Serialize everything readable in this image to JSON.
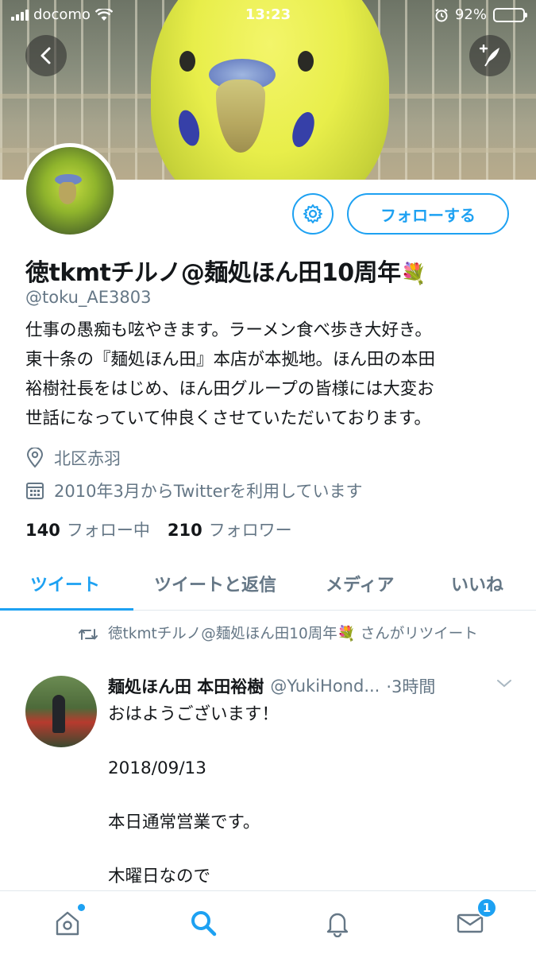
{
  "status_bar": {
    "carrier": "docomo",
    "time": "13:23",
    "battery": "92%",
    "battery_level": 0.92
  },
  "profile": {
    "display_name": "徳tkmtチルノ@麺処ほん田10周年",
    "display_name_emoji": "💐",
    "handle": "@toku_AE3803",
    "bio_lines": [
      "仕事の愚痴も呟やきます。ラーメン食べ歩き大好き。",
      "東十条の『麺処ほん田』本店が本拠地。ほん田の本田",
      "裕樹社長をはじめ、ほん田グループの皆様には大変お",
      "世話になっていて仲良くさせていただいております。"
    ],
    "location": "北区赤羽",
    "joined": "2010年3月からTwitterを利用しています",
    "following_count": "140",
    "following_label": "フォロー中",
    "followers_count": "210",
    "followers_label": "フォロワー",
    "follow_button": "フォローする"
  },
  "tabs": [
    "ツイート",
    "ツイートと返信",
    "メディア",
    "いいね"
  ],
  "active_tab": "ツイート",
  "tweet": {
    "retweet_line": "徳tkmtチルノ@麺処ほん田10周年💐 さんがリツイート",
    "author_name": "麺処ほん田 本田裕樹",
    "author_handle": "@YukiHond...",
    "time": "·3時間",
    "body_lines": [
      "おはようございます！",
      "",
      "2018/09/13",
      "",
      "本日通常営業です。",
      "",
      "木曜日なので"
    ]
  },
  "bottom_nav": {
    "messages_badge": "1"
  },
  "colors": {
    "accent": "#1da1f2",
    "secondary_text": "#657786"
  }
}
